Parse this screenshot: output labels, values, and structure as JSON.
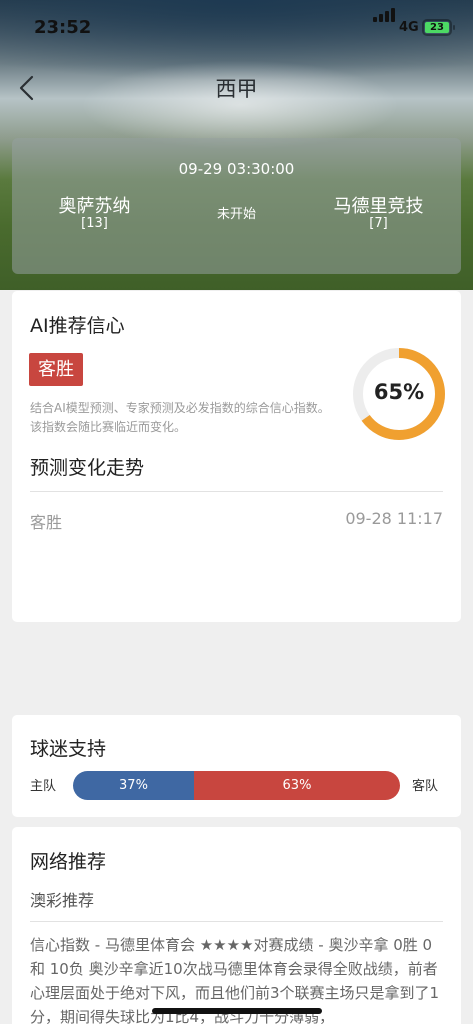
{
  "status_bar": {
    "time": "23:52",
    "network": "4G",
    "battery": "23"
  },
  "nav": {
    "title": "西甲"
  },
  "match": {
    "datetime": "09-29 03:30:00",
    "home_team": "奥萨苏纳",
    "home_rank": "[13]",
    "away_team": "马德里竞技",
    "away_rank": "[7]",
    "status": "未开始"
  },
  "ai_card": {
    "title": "AI推荐信心",
    "tag": "客胜",
    "description": "结合AI模型预测、专家预测及必发指数的综合信心指数。该指数会随比赛临近而变化。",
    "confidence_text": "65%",
    "confidence_fraction": 0.65,
    "ring_color": "#f0a030",
    "trend_title": "预测变化走势",
    "trend_items": [
      {
        "label": "客胜",
        "time": "09-28 11:17"
      }
    ]
  },
  "fan_support": {
    "title": "球迷支持",
    "home_label": "主队",
    "away_label": "客队",
    "home_pct_text": "37%",
    "away_pct_text": "63%",
    "home_fraction": 0.37,
    "home_color": "#3f68a3",
    "away_color": "#c8463f"
  },
  "web_recommend": {
    "title": "网络推荐",
    "subtitle": "澳彩推荐",
    "content": "信心指数 - 马德里体育会 ★★★★对赛成绩 - 奥沙辛拿 0胜 0和 10负 奥沙辛拿近10次战马德里体育会录得全败战绩，前者心理层面处于绝对下风，而且他们前3个联赛主场只是拿到了1分，期间得失球比为1比4，战斗力十分薄弱，"
  },
  "icons": {
    "back": "chevron-left-icon",
    "signal": "signal-icon",
    "battery": "battery-icon"
  }
}
